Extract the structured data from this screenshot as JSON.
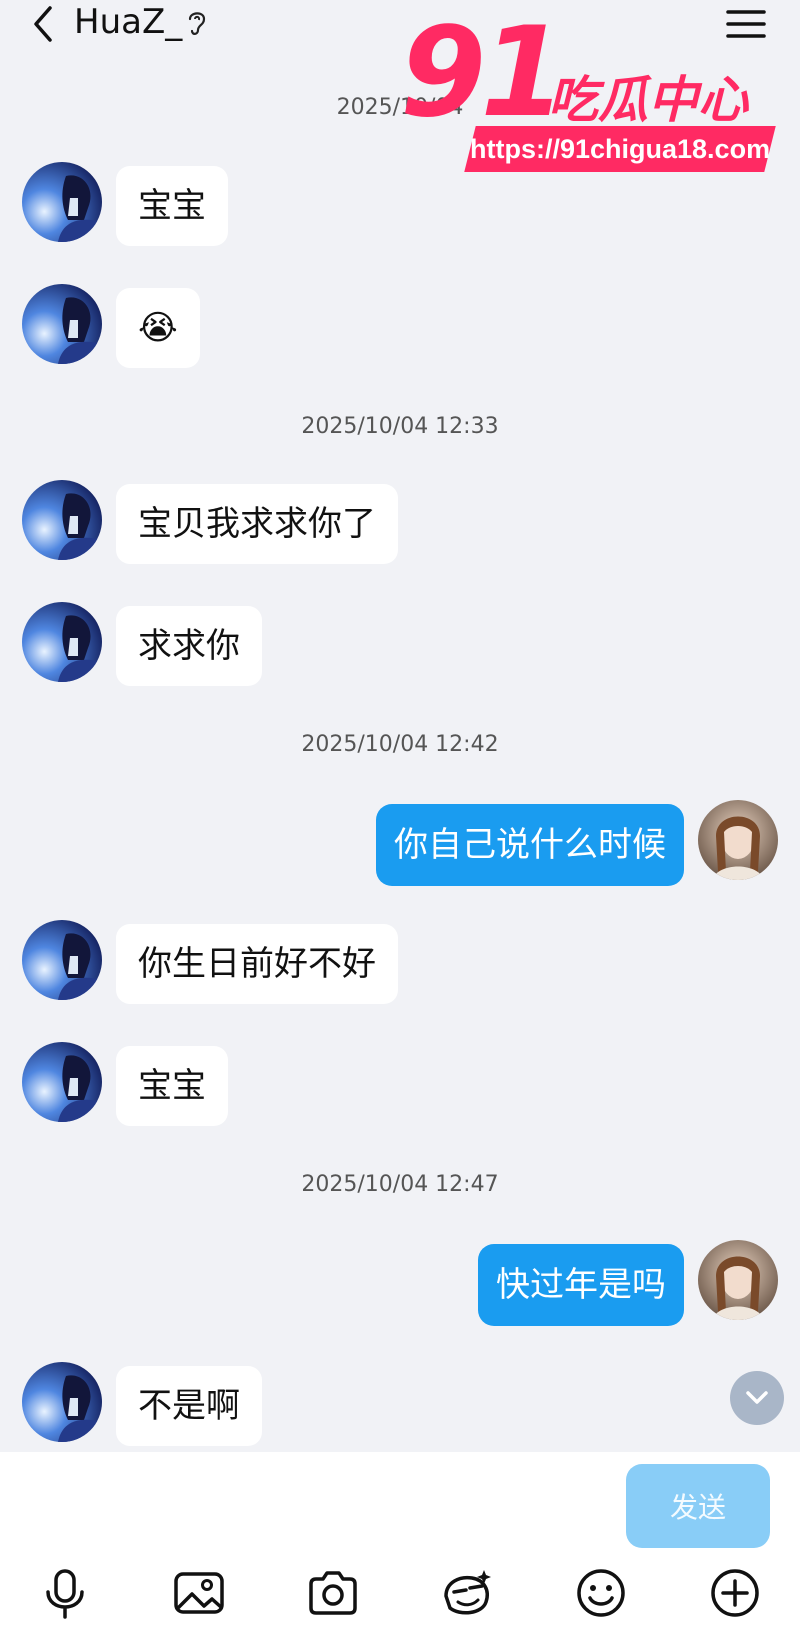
{
  "header": {
    "title": "HuaZ_",
    "icons": [
      "back-icon",
      "ear-icon",
      "menu-icon"
    ]
  },
  "watermark": {
    "number": "91",
    "text": "吃瓜中心",
    "url": "https://91chigua18.com"
  },
  "timestamps": [
    {
      "text": "2025/10/04"
    },
    {
      "text": "2025/10/04 12:33"
    },
    {
      "text": "2025/10/04 12:42"
    },
    {
      "text": "2025/10/04 12:47"
    }
  ],
  "messages": [
    {
      "sender": "other",
      "text": "宝宝"
    },
    {
      "sender": "other",
      "text": "😭"
    },
    {
      "sender": "other",
      "text": "宝贝我求求你了"
    },
    {
      "sender": "other",
      "text": "求求你"
    },
    {
      "sender": "me",
      "text": "你自己说什么时候"
    },
    {
      "sender": "other",
      "text": "你生日前好不好"
    },
    {
      "sender": "other",
      "text": "宝宝"
    },
    {
      "sender": "me",
      "text": "快过年是吗"
    },
    {
      "sender": "other",
      "text": "不是啊"
    }
  ],
  "composer": {
    "input_value": "",
    "send_label": "发送"
  },
  "toolbar": {
    "icons": [
      "microphone-icon",
      "image-icon",
      "camera-icon",
      "sticker-icon",
      "emoji-icon",
      "plus-icon"
    ]
  },
  "colors": {
    "background": "#f1f2f6",
    "my_bubble": "#1a9cf0",
    "other_bubble": "#ffffff",
    "send_button": "#89cdf7",
    "watermark": "#ff2a63"
  }
}
